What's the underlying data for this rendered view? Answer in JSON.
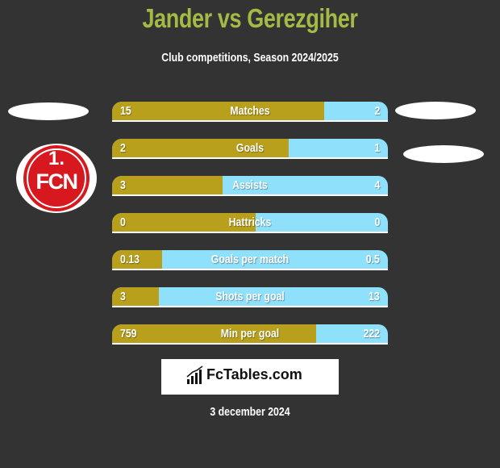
{
  "header": {
    "title": "Jander vs Gerezgiher",
    "subtitle": "Club competitions, Season 2024/2025"
  },
  "left_team": {
    "logo_text_line1": "1.",
    "logo_text_line2": "FCN",
    "logo_icon": "1fcn-crest-icon"
  },
  "colors": {
    "left": "#b9a01c",
    "right": "#8fe0fb",
    "title": "#a3bb45",
    "background": "#333333"
  },
  "stats": [
    {
      "label": "Matches",
      "left": "15",
      "right": "2",
      "left_fill": 0.77
    },
    {
      "label": "Goals",
      "left": "2",
      "right": "1",
      "left_fill": 0.64
    },
    {
      "label": "Assists",
      "left": "3",
      "right": "4",
      "left_fill": 0.4
    },
    {
      "label": "Hattricks",
      "left": "0",
      "right": "0",
      "left_fill": 0.52
    },
    {
      "label": "Goals per match",
      "left": "0.13",
      "right": "0.5",
      "left_fill": 0.18
    },
    {
      "label": "Shots per goal",
      "left": "3",
      "right": "13",
      "left_fill": 0.17
    },
    {
      "label": "Min per goal",
      "left": "759",
      "right": "222",
      "left_fill": 0.74
    }
  ],
  "brand": {
    "name": "FcTables.com",
    "icon": "bar-chart-icon"
  },
  "date": "3 december 2024"
}
